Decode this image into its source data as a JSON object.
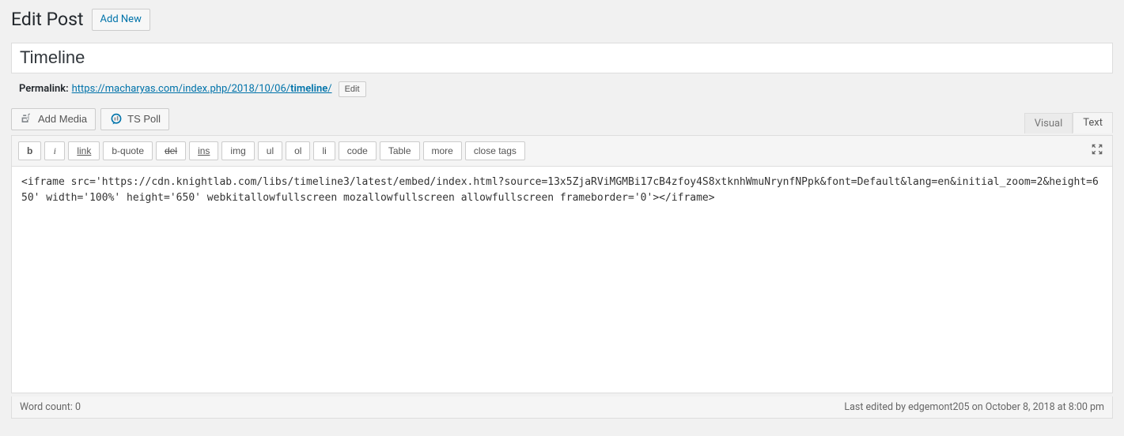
{
  "header": {
    "title": "Edit Post",
    "add_new": "Add New"
  },
  "post": {
    "title": "Timeline"
  },
  "permalink": {
    "label": "Permalink:",
    "base": "https://macharyas.com/index.php/2018/10/06/",
    "slug": "timeline",
    "trail": "/",
    "edit": "Edit"
  },
  "media": {
    "add_media": "Add Media",
    "ts_poll": "TS Poll"
  },
  "tabs": {
    "visual": "Visual",
    "text": "Text",
    "active": "text"
  },
  "quicktags": {
    "b": "b",
    "i": "i",
    "link": "link",
    "bquote": "b-quote",
    "del": "del",
    "ins": "ins",
    "img": "img",
    "ul": "ul",
    "ol": "ol",
    "li": "li",
    "code": "code",
    "table": "Table",
    "more": "more",
    "close": "close tags"
  },
  "editor": {
    "content": "<iframe src='https://cdn.knightlab.com/libs/timeline3/latest/embed/index.html?source=13x5ZjaRViMGMBi17cB4zfoy4S8xtknhWmuNrynfNPpk&font=Default&lang=en&initial_zoom=2&height=650' width='100%' height='650' webkitallowfullscreen mozallowfullscreen allowfullscreen frameborder='0'></iframe>"
  },
  "status": {
    "word_count_label": "Word count:",
    "word_count": "0",
    "last_edited": "Last edited by edgemont205 on October 8, 2018 at 8:00 pm"
  }
}
